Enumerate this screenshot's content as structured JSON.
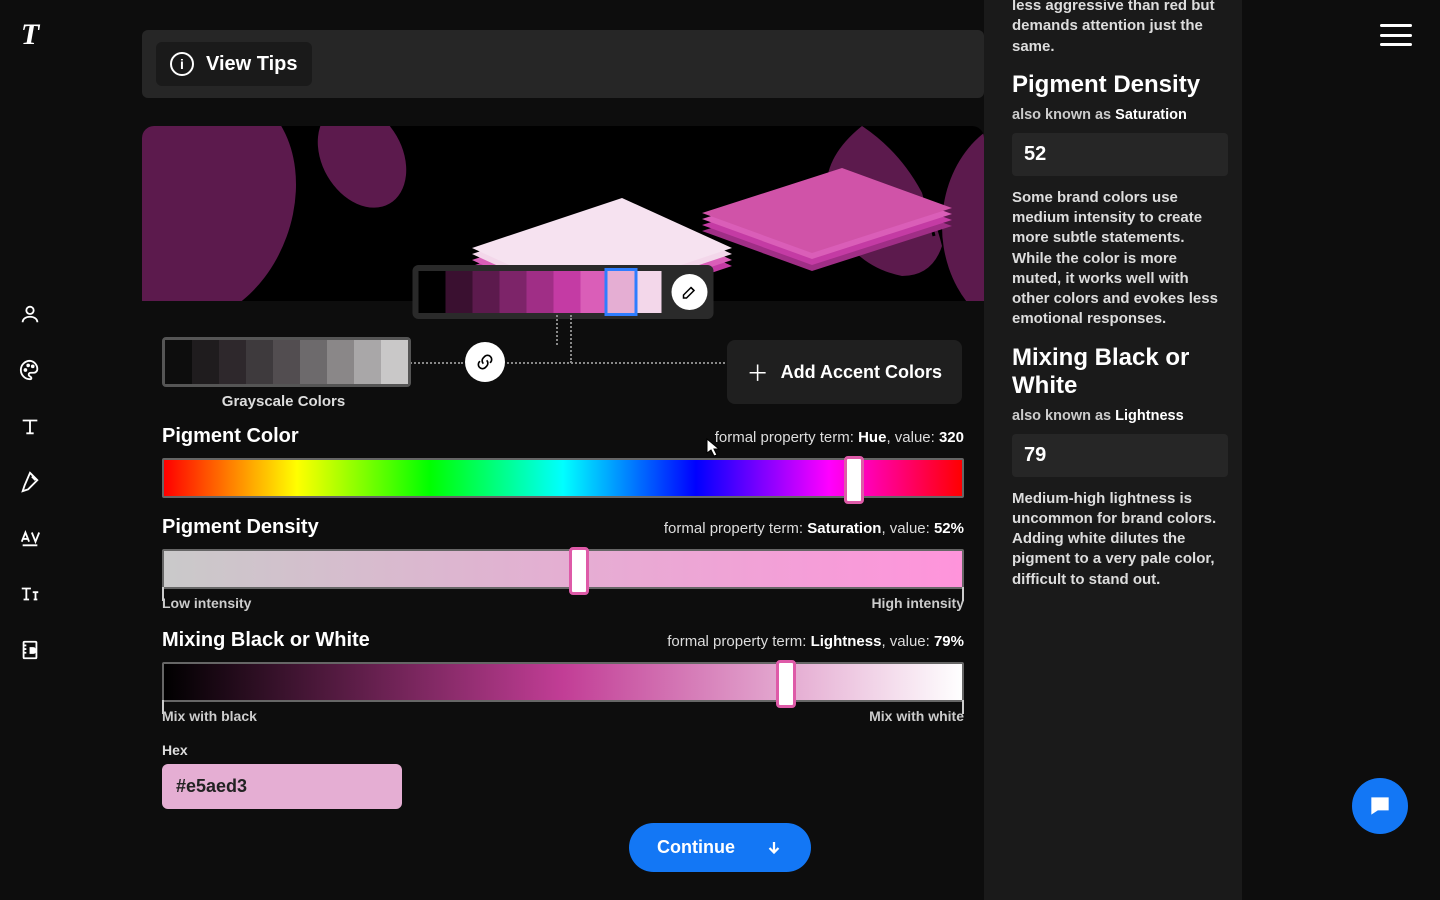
{
  "header": {
    "logo": "T",
    "tips_label": "View Tips"
  },
  "brand_swatches": [
    "#000000",
    "#3a1030",
    "#5c1a4d",
    "#7d2469",
    "#a02e86",
    "#c43ba4",
    "#da5eb8",
    "#e5aed3",
    "#f3d7ea"
  ],
  "brand_selected_index": 7,
  "gray_swatches": [
    "#0d0d0d",
    "#1f1c1e",
    "#2e282c",
    "#3e3a3d",
    "#524d50",
    "#6d6a6c",
    "#8a8788",
    "#a9a7a8",
    "#c9c8c8"
  ],
  "gray_label": "Grayscale Colors",
  "add_accent_label": "Add Accent Colors",
  "sliders": {
    "hue": {
      "title": "Pigment Color",
      "term_prefix": "formal property term: ",
      "term": "Hue",
      "value_prefix": ", value: ",
      "value": "320"
    },
    "sat": {
      "title": "Pigment Density",
      "term_prefix": "formal property term: ",
      "term": "Saturation",
      "value_prefix": ", value: ",
      "value": "52%",
      "low": "Low intensity",
      "high": "High intensity"
    },
    "light": {
      "title": "Mixing Black or White",
      "term_prefix": "formal property term: ",
      "term": "Lightness",
      "value_prefix": ", value: ",
      "value": "79%",
      "low": "Mix with black",
      "high": "Mix with white"
    }
  },
  "hex": {
    "label": "Hex",
    "value": "#e5aed3"
  },
  "continue_label": "Continue",
  "right": {
    "intro_partial": "less aggressive than red but demands attention just the same.",
    "density": {
      "heading": "Pigment Density",
      "aka_prefix": "also known as ",
      "aka": "Saturation",
      "value": "52",
      "desc": "Some brand colors use medium intensity to create more subtle statements. While the color is more muted, it works well with other colors and evokes less emotional responses."
    },
    "light": {
      "heading": "Mixing Black or White",
      "aka_prefix": "also known as ",
      "aka": "Lightness",
      "value": "79",
      "desc": "Medium-high lightness is uncommon for brand colors. Adding white dilutes the pigment to a very pale color, difficult to stand out."
    }
  }
}
